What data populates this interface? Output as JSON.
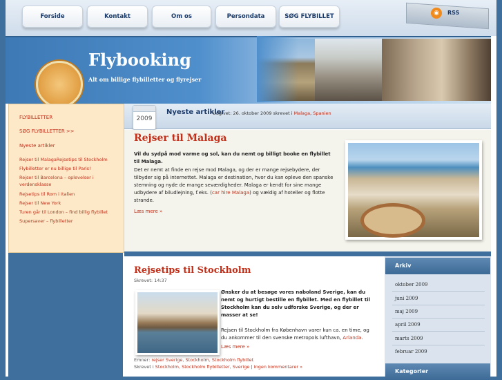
{
  "nav": {
    "items": [
      "Forside",
      "Kontakt",
      "Om os",
      "Persondata",
      "SØG FLYBILLET"
    ],
    "rss_label": "RSS"
  },
  "header": {
    "title": "Flybooking",
    "subtitle": "Alt om billige flybilletter og flyrejser"
  },
  "sidebar": {
    "items": [
      "FLYBILLETTER",
      "SØG FLYBILLETTER >>",
      "Nyeste artikler",
      "Rejser til MalagaRejsetips til Stockholm",
      "Flybilletter er nu billige til Paris!",
      "Rejser til Barcelona – oplevelser i",
      "verdensklasse",
      "Rejsetips til Rom i Italien",
      "Rejser til New York",
      "Turen går til London – find billig flybillet",
      "Supersaver – flybilletter"
    ]
  },
  "newest": {
    "year": "2009",
    "title": "Nyeste artikler",
    "meta_prefix": "Udgivet: 26. oktober 2009  skrevet i",
    "cat1": "Malaga",
    "sep": ",",
    "cat2": "Spanien"
  },
  "post1": {
    "title": "Rejser til Malaga",
    "lead": "Vil du sydpå mod varme og sol, kan du nemt og billigt booke en flybillet til Malaga.",
    "body_a": "Det er nemt at finde en rejse mod Malaga, og der er mange rejsebydere, der tilbyder sig på internettet. Malaga er destination, hvor du kan opleve den spanske stemning og nyde de mange seværdigheder. Malaga er kendt for sine mange udbydere af biludlejning, f.eks. (",
    "body_link": "car hire Malaga",
    "body_b": ") og vældig af hoteller og flotte strande.",
    "read_more": "Læs mere »"
  },
  "post2": {
    "title": "Rejsetips til Stockholm",
    "time": "Skrevet: 14:37",
    "lead": "Ønsker du at besøge vores naboland Sverige, kan du nemt og hurtigt bestille en flybillet. Med en flybillet til Stockholm kan du selv udforske Sverige, og der er masser at se!",
    "body_a": "Rejsen til Stockholm fra København varer kun ca. en time, og du ankommer til den svenske metropols lufthavn, ",
    "body_link": "Arlanda",
    "body_b": ".",
    "read_more": "Læs mere »",
    "tags_prefix": "Emner:",
    "tags": "rejser Sverige, Stockholm, Stockholm flybillet",
    "written_prefix": "Skrevet i",
    "written_cats": "Stockholm, Stockholm flybilletter, Sverige",
    "comments": "Ingen kommentarer »"
  },
  "archive": {
    "title": "Arkiv",
    "months": [
      "oktober 2009",
      "juni 2009",
      "maj 2009",
      "april 2009",
      "marts 2009",
      "februar 2009"
    ],
    "categories_title": "Kategorier"
  },
  "colors": {
    "accent": "#c0301a",
    "frame_blue": "#3f6f9c",
    "sidebar_bg": "#fde9c8"
  }
}
